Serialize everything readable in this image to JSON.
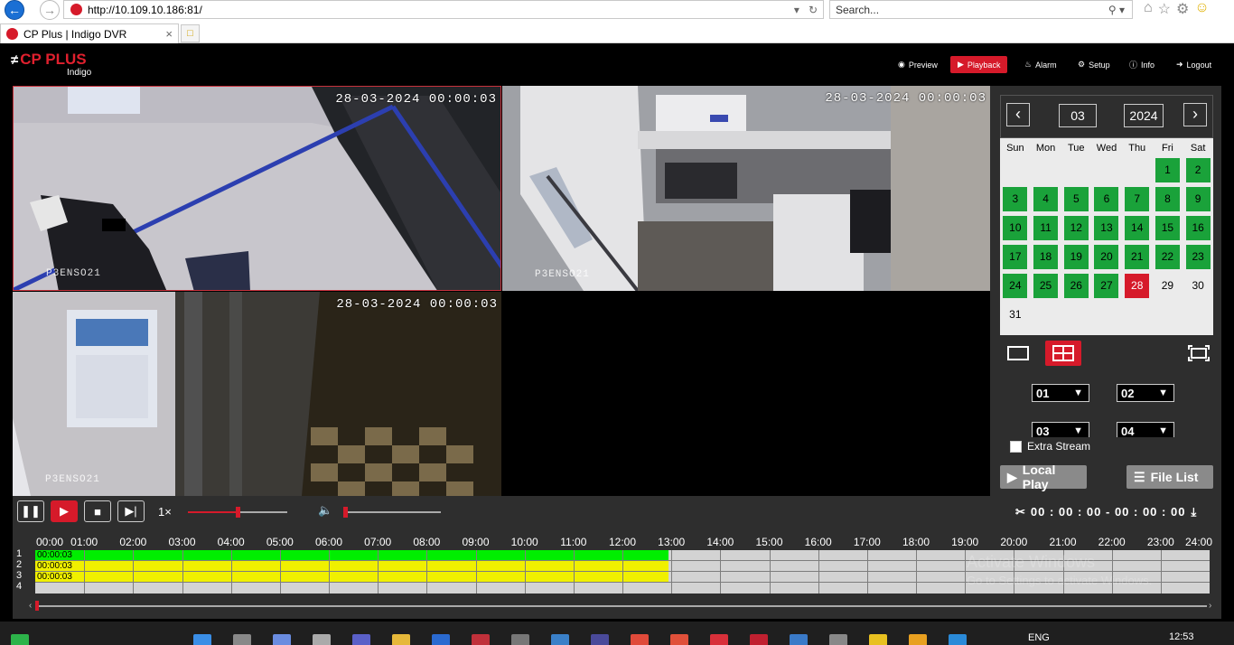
{
  "browser": {
    "url": "http://10.109.10.186:81/",
    "search_placeholder": "Search...",
    "tab_title": "CP Plus | Indigo DVR"
  },
  "header": {
    "logo": "CP PLUS",
    "logo_sub": "Indigo",
    "menu": [
      {
        "label": "Preview",
        "icon": "eye-icon"
      },
      {
        "label": "Playback",
        "icon": "play-circle-icon",
        "active": true
      },
      {
        "label": "Alarm",
        "icon": "bell-icon"
      },
      {
        "label": "Setup",
        "icon": "gear-icon"
      },
      {
        "label": "Info",
        "icon": "info-icon"
      },
      {
        "label": "Logout",
        "icon": "logout-icon"
      }
    ]
  },
  "cameras": [
    {
      "timestamp": "28-03-2024 00:00:03",
      "label": "P3ENSO21"
    },
    {
      "timestamp": "28-03-2024 00:00:03",
      "label": "P3ENSO21"
    },
    {
      "timestamp": "28-03-2024 00:00:03",
      "label": "P3ENSO21"
    },
    {
      "timestamp": "",
      "label": ""
    }
  ],
  "calendar": {
    "month": "03",
    "year": "2024",
    "weekdays": [
      "Sun",
      "Mon",
      "Tue",
      "Wed",
      "Thu",
      "Fri",
      "Sat"
    ],
    "leading_blanks": 5,
    "days_in_month": 31,
    "recorded_days": [
      1,
      2,
      3,
      4,
      5,
      6,
      7,
      8,
      9,
      10,
      11,
      12,
      13,
      14,
      15,
      16,
      17,
      18,
      19,
      20,
      21,
      22,
      23,
      24,
      25,
      26,
      27
    ],
    "selected_day": 28,
    "colors": {
      "recorded": "#1aa23a",
      "selected": "#d61a2a"
    }
  },
  "channels": {
    "ch1": "01",
    "ch2": "02",
    "ch3": "03",
    "ch4": "04"
  },
  "extra_stream_label": "Extra Stream",
  "buttons": {
    "local_play": "Local Play",
    "file_list": "File List"
  },
  "playback": {
    "speed": "1×",
    "speed_position": 0.5,
    "volume_position": 0.0,
    "time_range": "00 : 00 : 00 - 00 : 00 : 00"
  },
  "timeline": {
    "hour_labels": [
      "00:00",
      "01:00",
      "02:00",
      "03:00",
      "04:00",
      "05:00",
      "06:00",
      "07:00",
      "08:00",
      "09:00",
      "10:00",
      "11:00",
      "12:00",
      "13:00",
      "14:00",
      "15:00",
      "16:00",
      "17:00",
      "18:00",
      "19:00",
      "20:00",
      "21:00",
      "22:00",
      "23:00",
      "24:00"
    ],
    "rows": [
      {
        "label": "1",
        "stamp": "00:00:03",
        "end_hour": 12.95,
        "color": "#00ee00"
      },
      {
        "label": "2",
        "stamp": "00:00:03",
        "end_hour": 12.95,
        "color": "#f0f000"
      },
      {
        "label": "3",
        "stamp": "00:00:03",
        "end_hour": 12.95,
        "color": "#f0f000"
      },
      {
        "label": "4",
        "stamp": "",
        "end_hour": 0,
        "color": "#f0f000"
      }
    ]
  },
  "watermark": {
    "line1": "Activate Windows",
    "line2": "Go to Settings to activate Windows."
  },
  "taskbar": {
    "lang": "ENG",
    "time": "12:53"
  }
}
